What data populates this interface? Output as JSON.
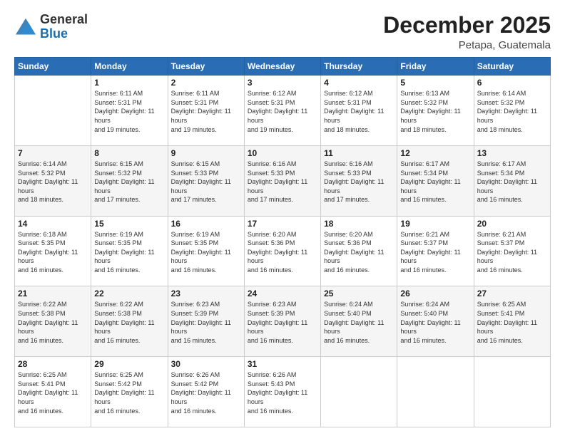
{
  "header": {
    "logo_general": "General",
    "logo_blue": "Blue",
    "month_title": "December 2025",
    "location": "Petapa, Guatemala"
  },
  "days_of_week": [
    "Sunday",
    "Monday",
    "Tuesday",
    "Wednesday",
    "Thursday",
    "Friday",
    "Saturday"
  ],
  "weeks": [
    [
      {
        "day": "",
        "sunrise": "",
        "sunset": "",
        "daylight": ""
      },
      {
        "day": "1",
        "sunrise": "Sunrise: 6:11 AM",
        "sunset": "Sunset: 5:31 PM",
        "daylight": "Daylight: 11 hours and 19 minutes."
      },
      {
        "day": "2",
        "sunrise": "Sunrise: 6:11 AM",
        "sunset": "Sunset: 5:31 PM",
        "daylight": "Daylight: 11 hours and 19 minutes."
      },
      {
        "day": "3",
        "sunrise": "Sunrise: 6:12 AM",
        "sunset": "Sunset: 5:31 PM",
        "daylight": "Daylight: 11 hours and 19 minutes."
      },
      {
        "day": "4",
        "sunrise": "Sunrise: 6:12 AM",
        "sunset": "Sunset: 5:31 PM",
        "daylight": "Daylight: 11 hours and 18 minutes."
      },
      {
        "day": "5",
        "sunrise": "Sunrise: 6:13 AM",
        "sunset": "Sunset: 5:32 PM",
        "daylight": "Daylight: 11 hours and 18 minutes."
      },
      {
        "day": "6",
        "sunrise": "Sunrise: 6:14 AM",
        "sunset": "Sunset: 5:32 PM",
        "daylight": "Daylight: 11 hours and 18 minutes."
      }
    ],
    [
      {
        "day": "7",
        "sunrise": "Sunrise: 6:14 AM",
        "sunset": "Sunset: 5:32 PM",
        "daylight": "Daylight: 11 hours and 18 minutes."
      },
      {
        "day": "8",
        "sunrise": "Sunrise: 6:15 AM",
        "sunset": "Sunset: 5:32 PM",
        "daylight": "Daylight: 11 hours and 17 minutes."
      },
      {
        "day": "9",
        "sunrise": "Sunrise: 6:15 AM",
        "sunset": "Sunset: 5:33 PM",
        "daylight": "Daylight: 11 hours and 17 minutes."
      },
      {
        "day": "10",
        "sunrise": "Sunrise: 6:16 AM",
        "sunset": "Sunset: 5:33 PM",
        "daylight": "Daylight: 11 hours and 17 minutes."
      },
      {
        "day": "11",
        "sunrise": "Sunrise: 6:16 AM",
        "sunset": "Sunset: 5:33 PM",
        "daylight": "Daylight: 11 hours and 17 minutes."
      },
      {
        "day": "12",
        "sunrise": "Sunrise: 6:17 AM",
        "sunset": "Sunset: 5:34 PM",
        "daylight": "Daylight: 11 hours and 16 minutes."
      },
      {
        "day": "13",
        "sunrise": "Sunrise: 6:17 AM",
        "sunset": "Sunset: 5:34 PM",
        "daylight": "Daylight: 11 hours and 16 minutes."
      }
    ],
    [
      {
        "day": "14",
        "sunrise": "Sunrise: 6:18 AM",
        "sunset": "Sunset: 5:35 PM",
        "daylight": "Daylight: 11 hours and 16 minutes."
      },
      {
        "day": "15",
        "sunrise": "Sunrise: 6:19 AM",
        "sunset": "Sunset: 5:35 PM",
        "daylight": "Daylight: 11 hours and 16 minutes."
      },
      {
        "day": "16",
        "sunrise": "Sunrise: 6:19 AM",
        "sunset": "Sunset: 5:35 PM",
        "daylight": "Daylight: 11 hours and 16 minutes."
      },
      {
        "day": "17",
        "sunrise": "Sunrise: 6:20 AM",
        "sunset": "Sunset: 5:36 PM",
        "daylight": "Daylight: 11 hours and 16 minutes."
      },
      {
        "day": "18",
        "sunrise": "Sunrise: 6:20 AM",
        "sunset": "Sunset: 5:36 PM",
        "daylight": "Daylight: 11 hours and 16 minutes."
      },
      {
        "day": "19",
        "sunrise": "Sunrise: 6:21 AM",
        "sunset": "Sunset: 5:37 PM",
        "daylight": "Daylight: 11 hours and 16 minutes."
      },
      {
        "day": "20",
        "sunrise": "Sunrise: 6:21 AM",
        "sunset": "Sunset: 5:37 PM",
        "daylight": "Daylight: 11 hours and 16 minutes."
      }
    ],
    [
      {
        "day": "21",
        "sunrise": "Sunrise: 6:22 AM",
        "sunset": "Sunset: 5:38 PM",
        "daylight": "Daylight: 11 hours and 16 minutes."
      },
      {
        "day": "22",
        "sunrise": "Sunrise: 6:22 AM",
        "sunset": "Sunset: 5:38 PM",
        "daylight": "Daylight: 11 hours and 16 minutes."
      },
      {
        "day": "23",
        "sunrise": "Sunrise: 6:23 AM",
        "sunset": "Sunset: 5:39 PM",
        "daylight": "Daylight: 11 hours and 16 minutes."
      },
      {
        "day": "24",
        "sunrise": "Sunrise: 6:23 AM",
        "sunset": "Sunset: 5:39 PM",
        "daylight": "Daylight: 11 hours and 16 minutes."
      },
      {
        "day": "25",
        "sunrise": "Sunrise: 6:24 AM",
        "sunset": "Sunset: 5:40 PM",
        "daylight": "Daylight: 11 hours and 16 minutes."
      },
      {
        "day": "26",
        "sunrise": "Sunrise: 6:24 AM",
        "sunset": "Sunset: 5:40 PM",
        "daylight": "Daylight: 11 hours and 16 minutes."
      },
      {
        "day": "27",
        "sunrise": "Sunrise: 6:25 AM",
        "sunset": "Sunset: 5:41 PM",
        "daylight": "Daylight: 11 hours and 16 minutes."
      }
    ],
    [
      {
        "day": "28",
        "sunrise": "Sunrise: 6:25 AM",
        "sunset": "Sunset: 5:41 PM",
        "daylight": "Daylight: 11 hours and 16 minutes."
      },
      {
        "day": "29",
        "sunrise": "Sunrise: 6:25 AM",
        "sunset": "Sunset: 5:42 PM",
        "daylight": "Daylight: 11 hours and 16 minutes."
      },
      {
        "day": "30",
        "sunrise": "Sunrise: 6:26 AM",
        "sunset": "Sunset: 5:42 PM",
        "daylight": "Daylight: 11 hours and 16 minutes."
      },
      {
        "day": "31",
        "sunrise": "Sunrise: 6:26 AM",
        "sunset": "Sunset: 5:43 PM",
        "daylight": "Daylight: 11 hours and 16 minutes."
      },
      {
        "day": "",
        "sunrise": "",
        "sunset": "",
        "daylight": ""
      },
      {
        "day": "",
        "sunrise": "",
        "sunset": "",
        "daylight": ""
      },
      {
        "day": "",
        "sunrise": "",
        "sunset": "",
        "daylight": ""
      }
    ]
  ]
}
